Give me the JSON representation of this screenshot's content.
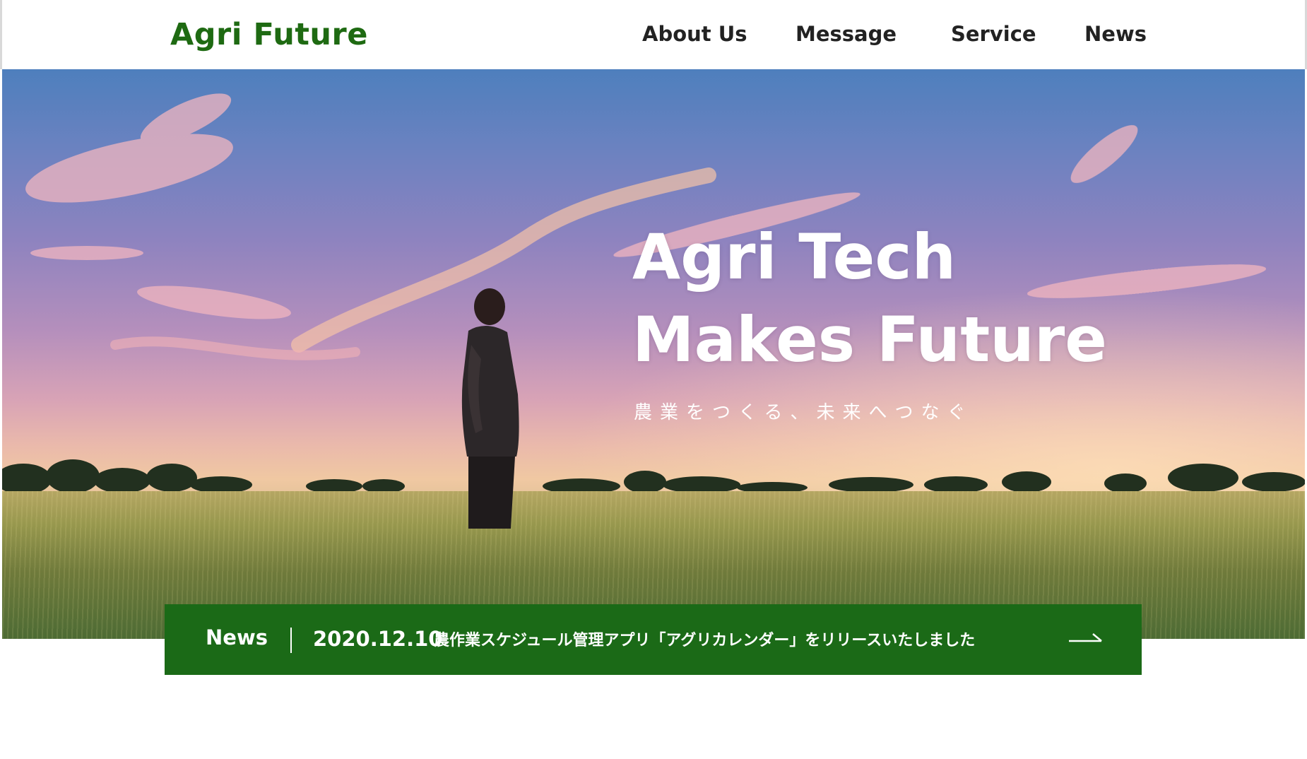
{
  "header": {
    "logo": "Agri Future",
    "nav": [
      "About Us",
      "Message",
      "Service",
      "News"
    ]
  },
  "hero": {
    "title_line1": "Agri Tech",
    "title_line2": "Makes Future",
    "subtitle": "農業をつくる、未来へつなぐ",
    "image": "photo of a man standing in a wheat field at sunset"
  },
  "news_bar": {
    "label": "News",
    "date": "2020.12.10",
    "text": "農作業スケジュール管理アプリ「アグリカレンダー」をリリースいたしました",
    "arrow_icon": "arrow-right-icon"
  },
  "colors": {
    "brand_green": "#1e6a12",
    "news_bar_bg": "#1b6a17",
    "nav_text": "#222222"
  }
}
